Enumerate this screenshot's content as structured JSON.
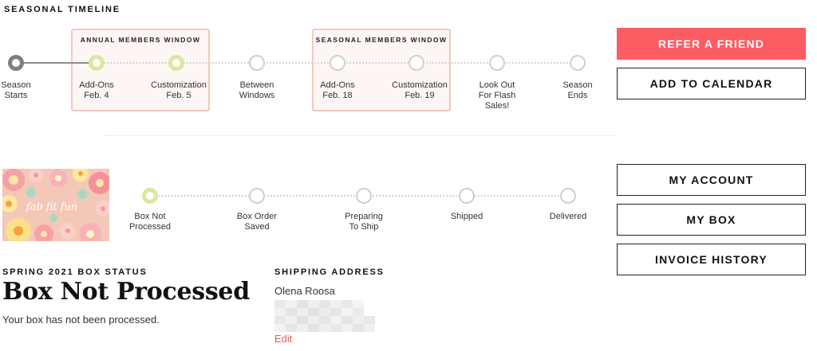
{
  "timeline": {
    "title": "SEASONAL TIMELINE",
    "windows": [
      {
        "title": "ANNUAL MEMBERS WINDOW"
      },
      {
        "title": "SEASONAL MEMBERS WINDOW"
      }
    ],
    "nodes": [
      {
        "label": "Season\nStarts",
        "state": "current"
      },
      {
        "label": "Add-Ons\nFeb. 4",
        "state": "active"
      },
      {
        "label": "Customization\nFeb. 5",
        "state": "active"
      },
      {
        "label": "Between\nWindows",
        "state": "upcoming"
      },
      {
        "label": "Add-Ons\nFeb. 18",
        "state": "upcoming"
      },
      {
        "label": "Customization\nFeb. 19",
        "state": "upcoming"
      },
      {
        "label": "Look Out\nFor Flash\nSales!",
        "state": "upcoming"
      },
      {
        "label": "Season\nEnds",
        "state": "upcoming"
      }
    ]
  },
  "actions": {
    "refer": "REFER A FRIEND",
    "calendar": "ADD TO CALENDAR",
    "account": "MY ACCOUNT",
    "box": "MY BOX",
    "invoices": "INVOICE HISTORY"
  },
  "box_progress": {
    "image_brand": "fab fit fun",
    "steps": [
      {
        "label": "Box Not\nProcessed",
        "state": "active"
      },
      {
        "label": "Box Order\nSaved",
        "state": "upcoming"
      },
      {
        "label": "Preparing\nTo Ship",
        "state": "upcoming"
      },
      {
        "label": "Shipped",
        "state": "upcoming"
      },
      {
        "label": "Delivered",
        "state": "upcoming"
      }
    ]
  },
  "status": {
    "heading": "SPRING 2021 BOX STATUS",
    "title": "Box Not Processed",
    "description": "Your box has not been processed."
  },
  "shipping": {
    "heading": "SHIPPING ADDRESS",
    "name": "Olena Roosa",
    "edit": "Edit"
  },
  "colors": {
    "accent": "#fb5d63",
    "active_ring": "#d8e8a0",
    "window_border": "#f6c7c0",
    "edit_link": "#e56060"
  }
}
